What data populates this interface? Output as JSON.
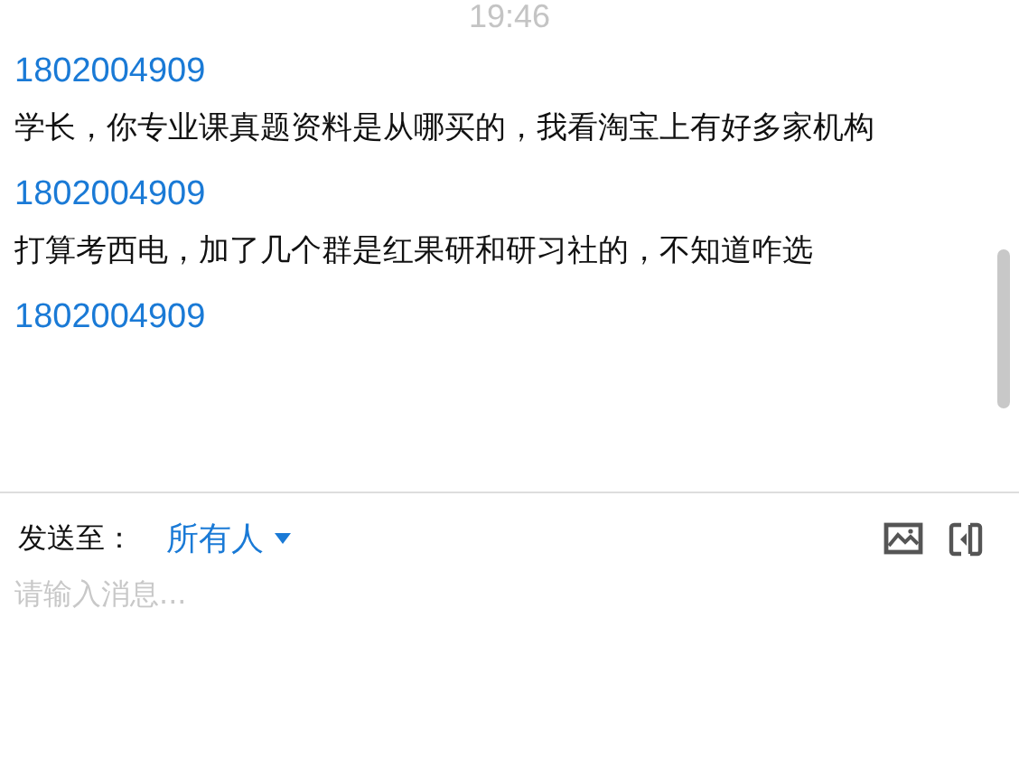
{
  "time": "19:46",
  "messages": [
    {
      "sender": "1802004909",
      "text": "学长，你专业课真题资料是从哪买的，我看淘宝上有好多家机构"
    },
    {
      "sender": "1802004909",
      "text": "打算考西电，加了几个群是红果研和研习社的，不知道咋选"
    },
    {
      "sender": "1802004909"
    }
  ],
  "composer": {
    "send_to_label": "发送至：",
    "recipient": "所有人",
    "placeholder": "请输入消息..."
  }
}
